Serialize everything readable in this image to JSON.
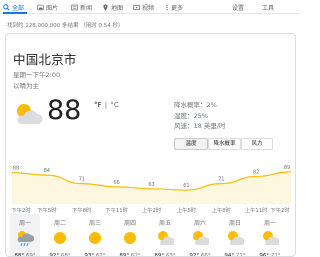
{
  "nav": {
    "tabs": [
      {
        "label": "全部",
        "icon": "search-icon"
      },
      {
        "label": "图片",
        "icon": "image-icon"
      },
      {
        "label": "新闻",
        "icon": "news-icon"
      },
      {
        "label": "地图",
        "icon": "map-pin-icon"
      },
      {
        "label": "视频",
        "icon": "video-icon"
      },
      {
        "label": "更多",
        "icon": "more-vert-icon"
      }
    ],
    "settings": "设置",
    "tools": "工具"
  },
  "stats": "找到约 128,000,000 条结果 （用时 0.54 秒）",
  "weather": {
    "city": "中国北京市",
    "datetime": "星期一下午2:00",
    "condition": "以晴为主",
    "temperature": "88",
    "unit_f": "°F",
    "unit_sep": "|",
    "unit_c": "°C",
    "details": [
      "降水概率：2%",
      "湿度：25%",
      "风速：18 英里/时"
    ],
    "buttons": [
      "温度",
      "降水概率",
      "风力"
    ],
    "selected_button": "温度"
  },
  "chart_data": {
    "type": "area",
    "title": "",
    "values": [
      88,
      84,
      71,
      66,
      63,
      61,
      71,
      82,
      89
    ],
    "point_labels": [
      "88",
      "84",
      "71",
      "66",
      "63",
      "61",
      "71",
      "82",
      "89"
    ],
    "x_labels": [
      "下午2时",
      "下午5时",
      "下午8时",
      "下午11时",
      "上午2时",
      "上午5时",
      "上午8时",
      "上午11时",
      "下午2时"
    ],
    "ylim": [
      55,
      95
    ],
    "color": "#fbbc04",
    "fill": "#fef7e0"
  },
  "forecast": [
    {
      "day": "周一",
      "icon": "cloud-rain-sun-icon",
      "high": "88°",
      "low": "69°"
    },
    {
      "day": "周二",
      "icon": "sunny-icon",
      "high": "92°",
      "low": "68°"
    },
    {
      "day": "周三",
      "icon": "sunny-icon",
      "high": "93°",
      "low": "62°"
    },
    {
      "day": "周四",
      "icon": "sunny-icon",
      "high": "89°",
      "low": "62°"
    },
    {
      "day": "周五",
      "icon": "partly-cloudy-icon",
      "high": "89°",
      "low": "63°"
    },
    {
      "day": "周六",
      "icon": "partly-cloudy-icon",
      "high": "92°",
      "low": "66°"
    },
    {
      "day": "周日",
      "icon": "partly-cloudy-icon",
      "high": "94°",
      "low": "71°"
    },
    {
      "day": "周一",
      "icon": "partly-cloudy-icon",
      "high": "96°",
      "low": "71°"
    }
  ]
}
